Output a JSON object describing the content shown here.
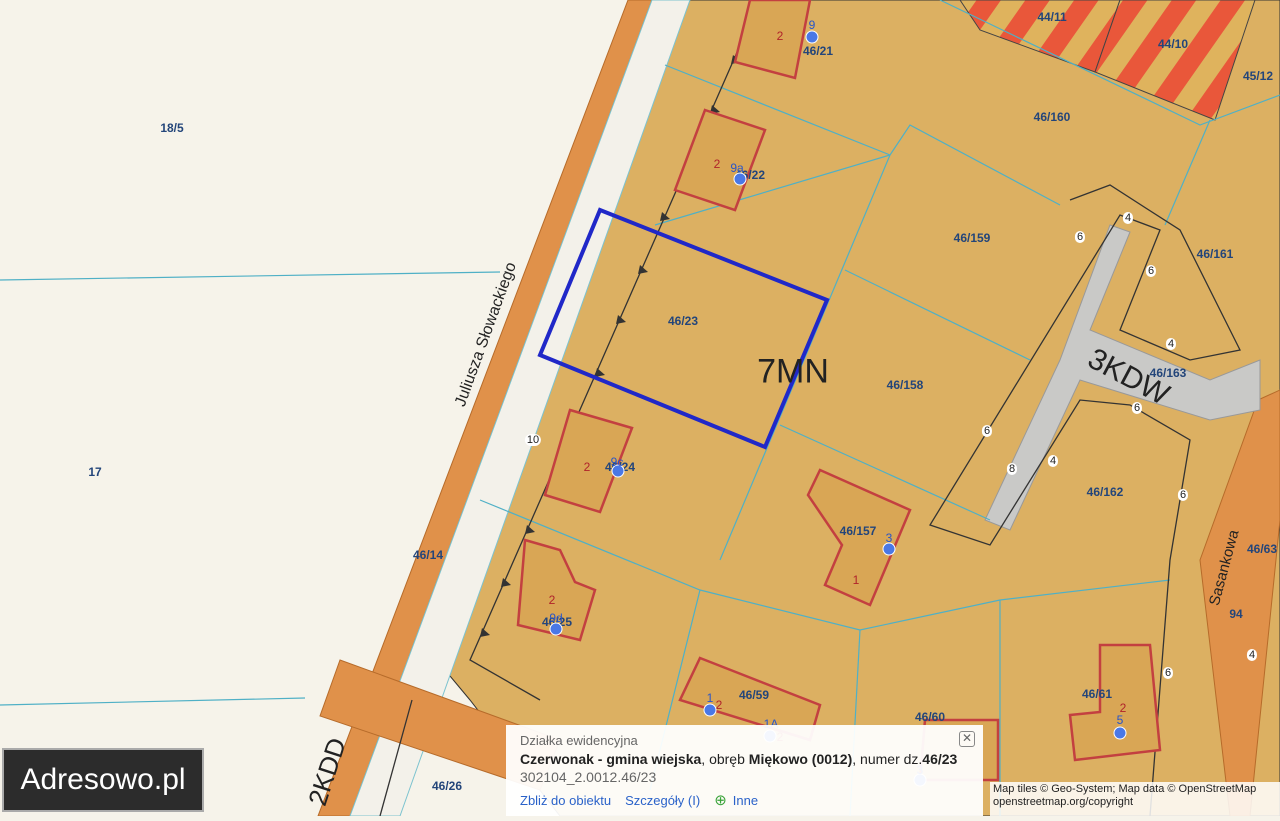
{
  "map": {
    "zone_label": "7MN",
    "road_label_3kdw": "3KDW",
    "road_label_2kdd": "2KDD",
    "streets": {
      "slowackiego": "Juliusza Słowackiego",
      "sasankowa": "Sasankowa"
    },
    "parcels": [
      {
        "label": "18/5"
      },
      {
        "label": "17"
      },
      {
        "label": "46/14"
      },
      {
        "label": "46/21"
      },
      {
        "label": "46/22"
      },
      {
        "label": "46/23"
      },
      {
        "label": "46/24"
      },
      {
        "label": "46/25"
      },
      {
        "label": "46/26"
      },
      {
        "label": "46/59"
      },
      {
        "label": "46/60"
      },
      {
        "label": "46/61"
      },
      {
        "label": "46/157"
      },
      {
        "label": "46/158"
      },
      {
        "label": "46/159"
      },
      {
        "label": "46/160"
      },
      {
        "label": "46/161"
      },
      {
        "label": "46/162"
      },
      {
        "label": "46/163"
      },
      {
        "label": "44/11"
      },
      {
        "label": "44/10"
      },
      {
        "label": "45/12"
      },
      {
        "label": "46/63"
      },
      {
        "label": "94"
      }
    ],
    "building_storeys": [
      "2",
      "2",
      "2",
      "2",
      "1",
      "2",
      "2",
      "2"
    ],
    "address_numbers": [
      "9",
      "9a",
      "9c",
      "9d",
      "3",
      "1",
      "1A",
      "5",
      "3"
    ],
    "road_widths": [
      "10",
      "6",
      "4",
      "6",
      "8",
      "4",
      "6",
      "6",
      "4",
      "6",
      "6",
      "4"
    ]
  },
  "logo": "Adresowo.pl",
  "popup": {
    "category": "Działka ewidencyjna",
    "municipality": "Czerwonak - gmina wiejska",
    "district_prefix": ", obręb ",
    "district": "Miękowo (0012)",
    "number_prefix": ", numer dz.",
    "parcel_number": "46/23",
    "identifier": "302104_2.0012.46/23",
    "actions": {
      "zoom": "Zbliż do obiektu",
      "details": "Szczegóły (I)",
      "other": "Inne"
    }
  },
  "attribution": {
    "line1": "Map tiles © Geo-System; Map data © OpenStreetMap",
    "line2": "openstreetmap.org/copyright"
  }
}
